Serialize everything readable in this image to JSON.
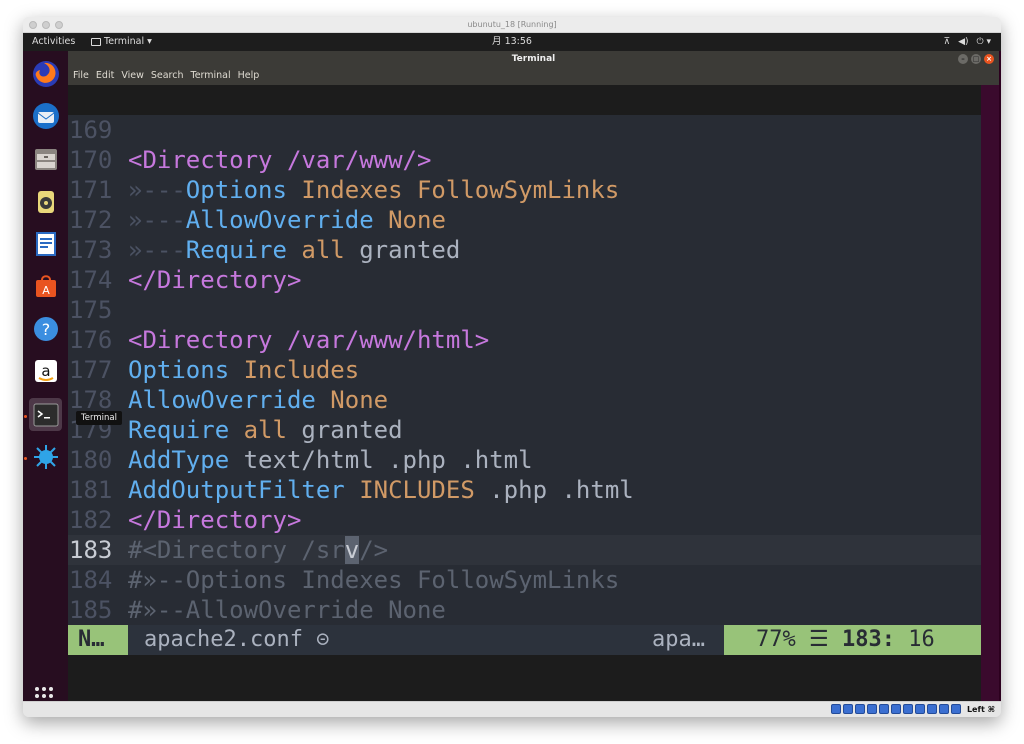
{
  "host": {
    "title": "ubunutu_18 [Running]",
    "host_key": "Left ⌘"
  },
  "topbar": {
    "activities": "Activities",
    "app_menu": "Terminal ▾",
    "clock": "月 13:56",
    "tray_icons": [
      "network-icon",
      "volume-icon",
      "power-icon"
    ]
  },
  "dock": {
    "items": [
      "firefox",
      "thunderbird",
      "files",
      "rhythmbox",
      "libreoffice-writer",
      "ubuntu-software",
      "help",
      "amazon",
      "terminal",
      "other-app"
    ],
    "tooltip": "Terminal"
  },
  "terminal": {
    "title": "Terminal",
    "menu": [
      "File",
      "Edit",
      "View",
      "Search",
      "Terminal",
      "Help"
    ]
  },
  "editor": {
    "lines": [
      {
        "num": "169",
        "parts": []
      },
      {
        "num": "170",
        "parts": [
          {
            "c": "tag",
            "t": "<Directory /var/www/>"
          }
        ]
      },
      {
        "num": "171",
        "parts": [
          {
            "c": "ws",
            "t": "»---"
          },
          {
            "c": "kw",
            "t": "Options "
          },
          {
            "c": "val",
            "t": "Indexes FollowSymLinks"
          }
        ]
      },
      {
        "num": "172",
        "parts": [
          {
            "c": "ws",
            "t": "»---"
          },
          {
            "c": "kw",
            "t": "AllowOverride "
          },
          {
            "c": "val",
            "t": "None"
          }
        ]
      },
      {
        "num": "173",
        "parts": [
          {
            "c": "ws",
            "t": "»---"
          },
          {
            "c": "kw",
            "t": "Require "
          },
          {
            "c": "val",
            "t": "all "
          },
          {
            "c": "txt",
            "t": "granted"
          }
        ]
      },
      {
        "num": "174",
        "parts": [
          {
            "c": "tag",
            "t": "</Directory>"
          }
        ]
      },
      {
        "num": "175",
        "parts": []
      },
      {
        "num": "176",
        "parts": [
          {
            "c": "tag",
            "t": "<Directory /var/www/html>"
          }
        ]
      },
      {
        "num": "177",
        "parts": [
          {
            "c": "kw",
            "t": "Options "
          },
          {
            "c": "val",
            "t": "Includes"
          }
        ]
      },
      {
        "num": "178",
        "parts": [
          {
            "c": "kw",
            "t": "AllowOverride "
          },
          {
            "c": "val",
            "t": "None"
          }
        ]
      },
      {
        "num": "179",
        "parts": [
          {
            "c": "kw",
            "t": "Require "
          },
          {
            "c": "val",
            "t": "all "
          },
          {
            "c": "txt",
            "t": "granted"
          }
        ]
      },
      {
        "num": "180",
        "parts": [
          {
            "c": "kw",
            "t": "AddType "
          },
          {
            "c": "txt",
            "t": "text/html .php .html"
          }
        ]
      },
      {
        "num": "181",
        "parts": [
          {
            "c": "kw",
            "t": "AddOutputFilter "
          },
          {
            "c": "val",
            "t": "INCLUDES "
          },
          {
            "c": "txt",
            "t": ".php .html"
          }
        ]
      },
      {
        "num": "182",
        "parts": [
          {
            "c": "tag",
            "t": "</Directory>"
          }
        ]
      },
      {
        "num": "183",
        "current": true,
        "parts": [
          {
            "c": "cmt",
            "t": "#<Directory /sr"
          },
          {
            "c": "cursor",
            "t": "v"
          },
          {
            "c": "cmt",
            "t": "/>"
          }
        ]
      },
      {
        "num": "184",
        "parts": [
          {
            "c": "cmt",
            "t": "#»--Options Indexes FollowSymLinks"
          }
        ]
      },
      {
        "num": "185",
        "parts": [
          {
            "c": "cmt",
            "t": "#»--AllowOverride None"
          }
        ]
      }
    ]
  },
  "statusline": {
    "mode": "N…",
    "filename": "apache2.conf ⊝",
    "filetype": "apa…",
    "percent": "77%",
    "line_icon": "☰",
    "line": "183:",
    "col": "16"
  }
}
